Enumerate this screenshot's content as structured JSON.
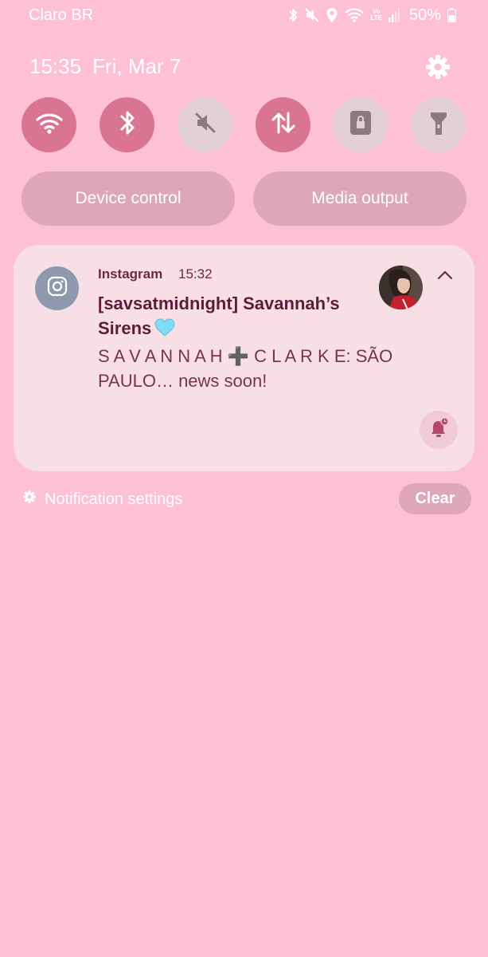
{
  "status_bar": {
    "carrier": "Claro BR",
    "volte_line1": "Vo",
    "volte_line2": "LTE",
    "battery_percent": "50%",
    "icons": [
      "bluetooth-icon",
      "mute-icon",
      "location-icon",
      "wifi-icon",
      "volte-icon",
      "signal-icon",
      "battery-icon"
    ]
  },
  "header": {
    "time": "15:35",
    "date": "Fri, Mar 7",
    "settings_icon": "gear-icon"
  },
  "quick_toggles": [
    {
      "name": "wifi",
      "icon": "wifi-icon",
      "state": "on"
    },
    {
      "name": "bluetooth",
      "icon": "bluetooth-icon",
      "state": "on"
    },
    {
      "name": "sound",
      "icon": "mute-icon",
      "state": "off"
    },
    {
      "name": "mobile-data",
      "icon": "data-arrows-icon",
      "state": "on"
    },
    {
      "name": "rotation-lock",
      "icon": "lock-icon",
      "state": "off"
    },
    {
      "name": "flashlight",
      "icon": "flashlight-icon",
      "state": "off"
    }
  ],
  "buttons": {
    "device_control": "Device control",
    "media_output": "Media output"
  },
  "notification": {
    "app_name": "Instagram",
    "time": "15:32",
    "title": "[savsatmidnight] Savannah’s Sirens",
    "body": "S A V A N N A H ➕ C L A R K E: SÃO PAULO… news soon!",
    "app_icon": "instagram-icon",
    "title_emoji": "light-blue-heart-icon"
  },
  "footer": {
    "notification_settings": "Notification settings",
    "clear": "Clear"
  },
  "colors": {
    "background": "#fec0d7",
    "toggle_on": "#d97592",
    "toggle_off": "#e3d0d6",
    "pill": "#dda6ba",
    "card": "#f8dfe6",
    "title_text": "#5e1b3a"
  }
}
